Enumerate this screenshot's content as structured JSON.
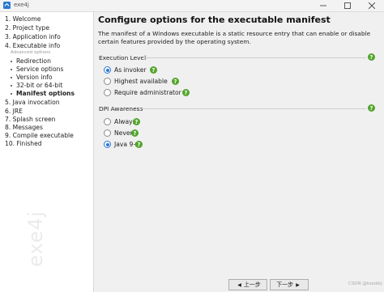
{
  "window": {
    "title": "exe4j"
  },
  "sidebar": {
    "items": [
      {
        "label": "1. Welcome"
      },
      {
        "label": "2. Project type"
      },
      {
        "label": "3. Application info"
      },
      {
        "label": "4. Executable info"
      }
    ],
    "advanced_caption": "Advanced options",
    "sub_items": [
      {
        "label": "Redirection"
      },
      {
        "label": "Service options"
      },
      {
        "label": "Version info"
      },
      {
        "label": "32-bit or 64-bit"
      },
      {
        "label": "Manifest options"
      }
    ],
    "items_after": [
      {
        "label": "5. Java invocation"
      },
      {
        "label": "6. JRE"
      },
      {
        "label": "7. Splash screen"
      },
      {
        "label": "8. Messages"
      },
      {
        "label": "9. Compile executable"
      },
      {
        "label": "10. Finished"
      }
    ],
    "watermark": "exe4j"
  },
  "main": {
    "heading": "Configure options for the executable manifest",
    "description": "The manifest of a Windows executable is a static resource entry that can enable or disable certain features provided by the operating system.",
    "execution_level": {
      "label": "Execution Level",
      "options": [
        "As invoker",
        "Highest available",
        "Require administrator"
      ],
      "selected": "As invoker"
    },
    "dpi_awareness": {
      "label": "DPI Awareness",
      "options": [
        "Always",
        "Never",
        "Java 9+"
      ],
      "selected": "Java 9+"
    }
  },
  "buttons": {
    "prev": "上一步",
    "next": "下一步",
    "note": "CSDN @toeddy"
  },
  "colors": {
    "accent": "#2a78d3",
    "help_icon": "#52a52a"
  }
}
